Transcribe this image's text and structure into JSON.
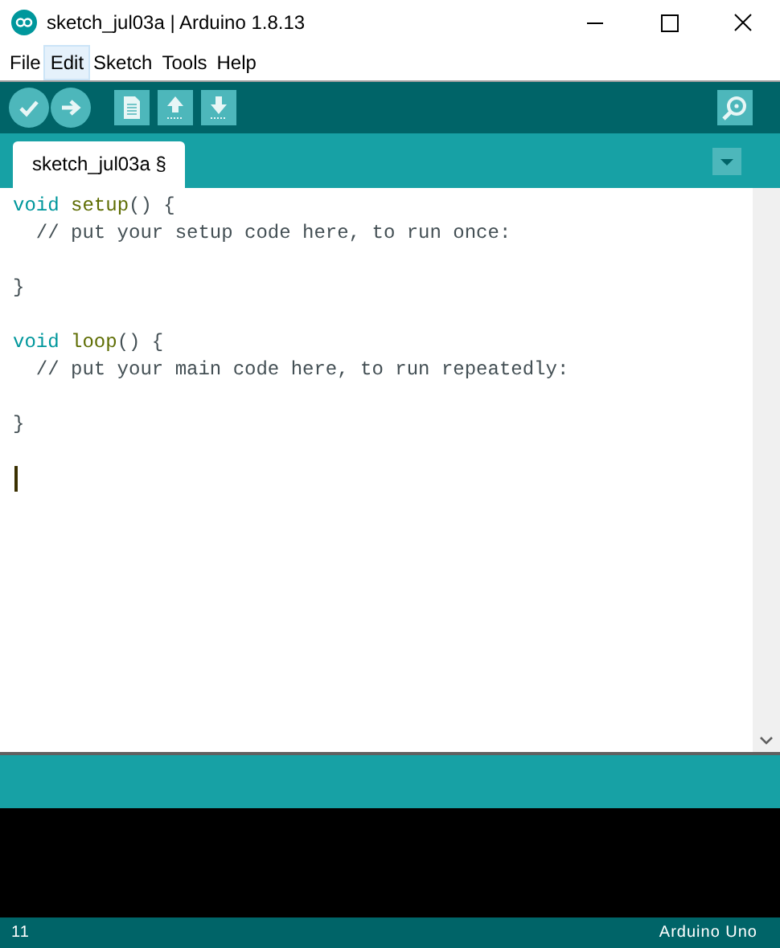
{
  "window": {
    "title": "sketch_jul03a | Arduino 1.8.13"
  },
  "menu": [
    {
      "label": "File",
      "highlighted": false
    },
    {
      "label": "Edit",
      "highlighted": true
    },
    {
      "label": "Sketch",
      "highlighted": false
    },
    {
      "label": "Tools",
      "highlighted": false
    },
    {
      "label": "Help",
      "highlighted": false
    }
  ],
  "toolbar": [
    {
      "kind": "verify"
    },
    {
      "kind": "upload"
    },
    {
      "kind": "new"
    },
    {
      "kind": "open"
    },
    {
      "kind": "save"
    }
  ],
  "tabs": [
    {
      "label": "sketch_jul03a §",
      "selected": true
    }
  ],
  "editor": {
    "lines": [
      {
        "kind": "code",
        "tokens": [
          {
            "text": "void ",
            "kind": "keyword"
          },
          {
            "text": "setup",
            "kind": "function"
          },
          {
            "text": "() {",
            "kind": "plain"
          }
        ]
      },
      {
        "kind": "code",
        "tokens": [
          {
            "text": "  // put your setup code here, to run once:",
            "kind": "comment"
          }
        ]
      },
      {
        "kind": "blank"
      },
      {
        "kind": "code",
        "tokens": [
          {
            "text": "}",
            "kind": "plain"
          }
        ]
      },
      {
        "kind": "blank"
      },
      {
        "kind": "code",
        "tokens": [
          {
            "text": "void ",
            "kind": "keyword"
          },
          {
            "text": "loop",
            "kind": "function"
          },
          {
            "text": "() {",
            "kind": "plain"
          }
        ]
      },
      {
        "kind": "code",
        "tokens": [
          {
            "text": "  // put your main code here, to run repeatedly:",
            "kind": "comment"
          }
        ]
      },
      {
        "kind": "blank"
      },
      {
        "kind": "code",
        "tokens": [
          {
            "text": "}",
            "kind": "plain"
          }
        ]
      },
      {
        "kind": "blank"
      },
      {
        "kind": "cursor"
      }
    ]
  },
  "status_bar": {
    "line": "11",
    "board": "Arduino Uno"
  }
}
